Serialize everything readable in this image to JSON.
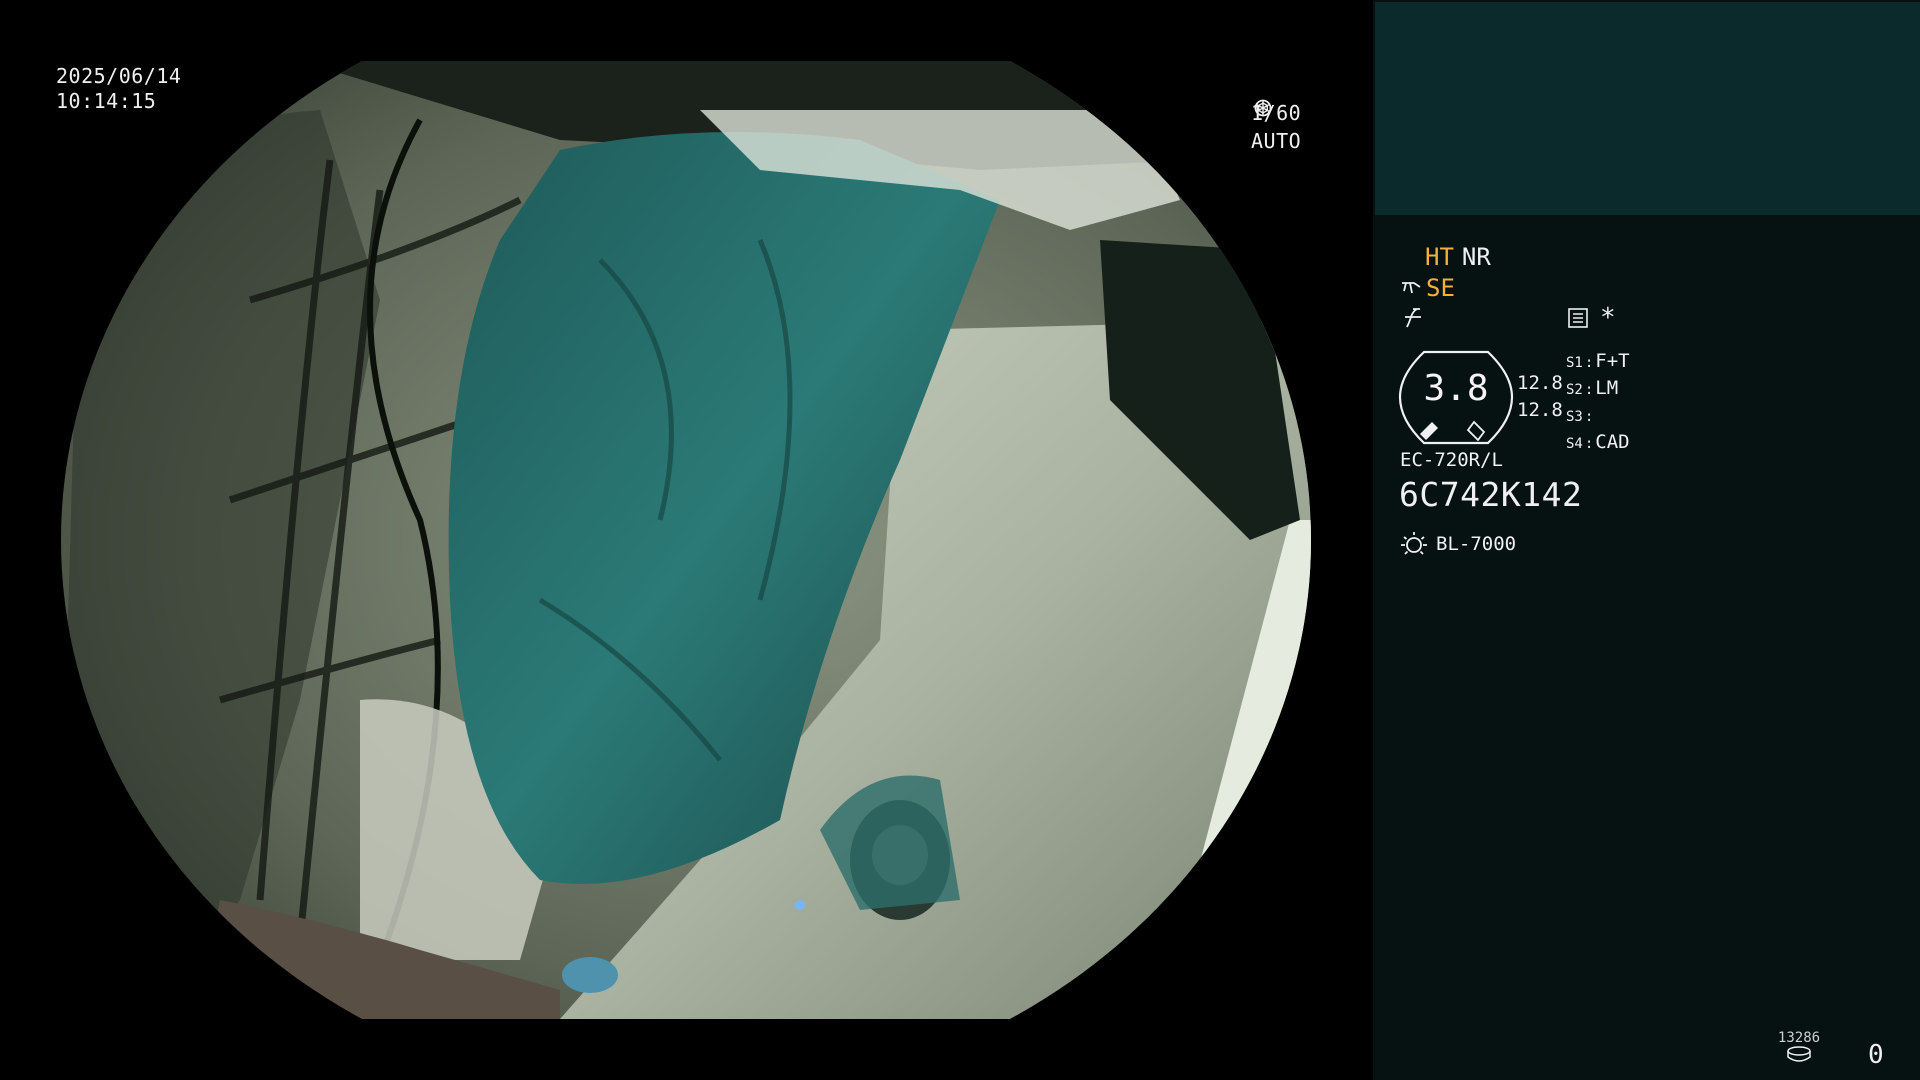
{
  "osd": {
    "date": "2025/06/14",
    "time": "10:14:15",
    "shutter": "1/60",
    "iris_mode": "AUTO",
    "icons": [
      "shutter-icon",
      "iris-auto-icon"
    ]
  },
  "panel": {
    "ht": "HT",
    "nr": "NR",
    "se": "SE",
    "icons": [
      "distal-tip-icon",
      "enhancement-icon",
      "menu-list-icon",
      "light-source-icon",
      "storage-icon"
    ],
    "asterisk": "*",
    "zoom_value": "3.8",
    "zoom_sub_1": "12.8",
    "zoom_sub_2": "12.8",
    "switches": [
      {
        "label": "S1",
        "value": "F+T"
      },
      {
        "label": "S2",
        "value": "LM"
      },
      {
        "label": "S3",
        "value": ""
      },
      {
        "label": "S4",
        "value": "CAD"
      }
    ],
    "scope_model": "EC-720R/L",
    "serial": "6C742K142",
    "light_source": "BL-7000",
    "counter": "13286",
    "page": "0",
    "colors": {
      "panel_bg": "#061112",
      "thumb_bg": "#0b2a2b",
      "accent": "#f2b13a"
    }
  }
}
